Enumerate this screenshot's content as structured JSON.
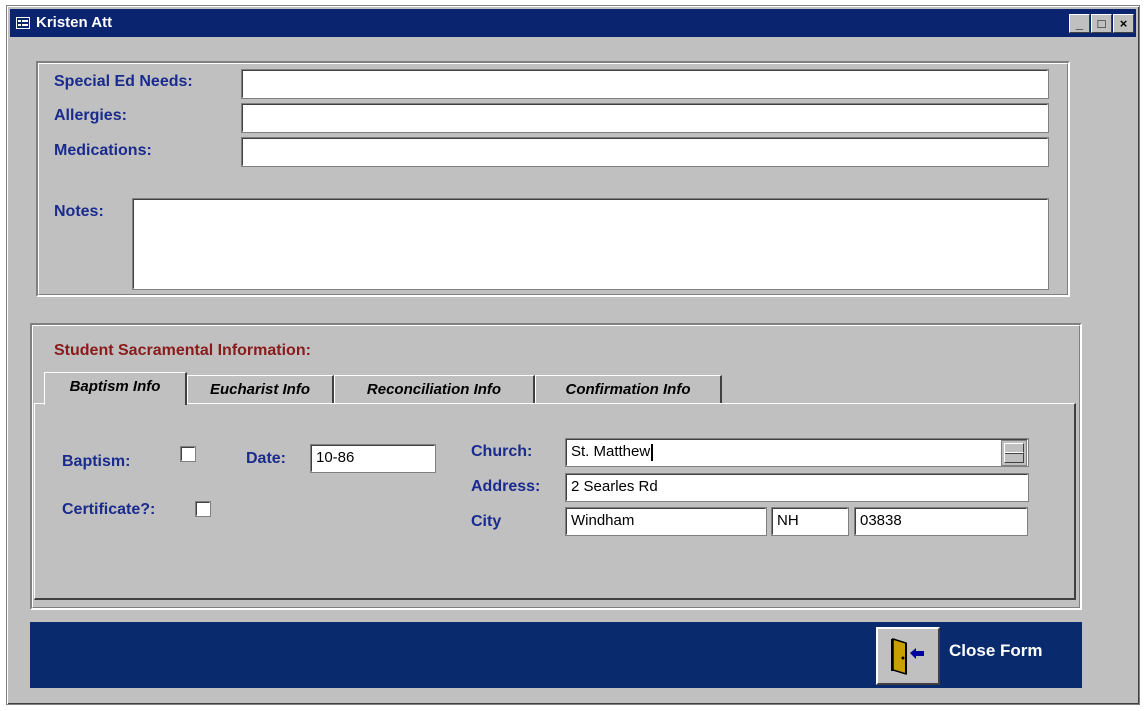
{
  "window": {
    "title": "Kristen Att",
    "controls": {
      "minimize": "_",
      "maximize": "□",
      "close": "×"
    }
  },
  "health": {
    "special_ed_label": "Special Ed Needs:",
    "special_ed_value": "",
    "allergies_label": "Allergies:",
    "allergies_value": "",
    "medications_label": "Medications:",
    "medications_value": "",
    "notes_label": "Notes:",
    "notes_value": ""
  },
  "sacramental": {
    "heading": "Student Sacramental Information:",
    "heading_color": "#8b1a1a",
    "tabs": [
      {
        "label": "Baptism Info",
        "active": true
      },
      {
        "label": "Eucharist Info",
        "active": false
      },
      {
        "label": "Reconciliation Info",
        "active": false
      },
      {
        "label": "Confirmation Info",
        "active": false
      }
    ],
    "baptism": {
      "baptism_label": "Baptism:",
      "baptism_checked": false,
      "certificate_label": "Certificate?:",
      "certificate_checked": false,
      "date_label": "Date:",
      "date_value": "10-86",
      "church_label": "Church:",
      "church_value": "St. Matthew",
      "address_label": "Address:",
      "address_value": "2 Searles Rd",
      "city_label": "City",
      "city_value": "Windham",
      "state_value": "NH",
      "zip_value": "03838"
    }
  },
  "footer": {
    "close_label": "Close Form",
    "background": "#0a2a6e"
  },
  "colors": {
    "titlebar": "#0a2470",
    "label": "#1a2b8e",
    "form_bg": "#c0c0c0"
  }
}
